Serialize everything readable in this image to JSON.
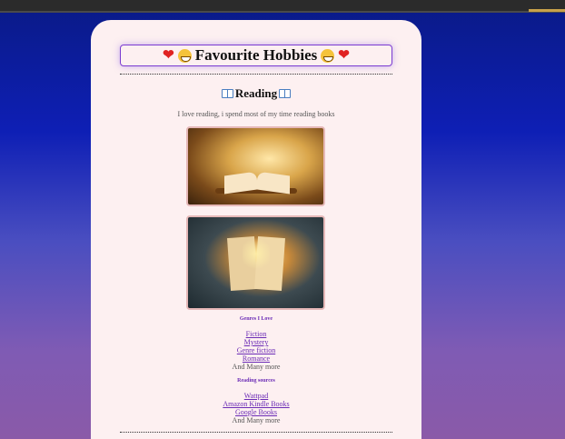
{
  "title": "Favourite Hobbies",
  "icons": {
    "title_left": [
      "heart-icon",
      "grin-icon"
    ],
    "title_right": [
      "grin-icon",
      "heart-icon"
    ],
    "section": "open-book-icon"
  },
  "colors": {
    "link": "#6a2ab5",
    "card": "#fdf0f1",
    "heading_border": "#7a3bd1"
  },
  "section": {
    "title": "Reading",
    "intro": "I love reading, i spend most of my time reading books"
  },
  "genres": {
    "heading": "Genres I Love",
    "links": [
      "Fiction",
      "Mystery",
      "Genre fiction",
      "Romance"
    ],
    "more": "And Many more"
  },
  "sources": {
    "heading": "Reading sources",
    "links": [
      "Wattpad",
      "Amazon Kindle Books",
      "Google Books"
    ],
    "more": "And Many more"
  }
}
